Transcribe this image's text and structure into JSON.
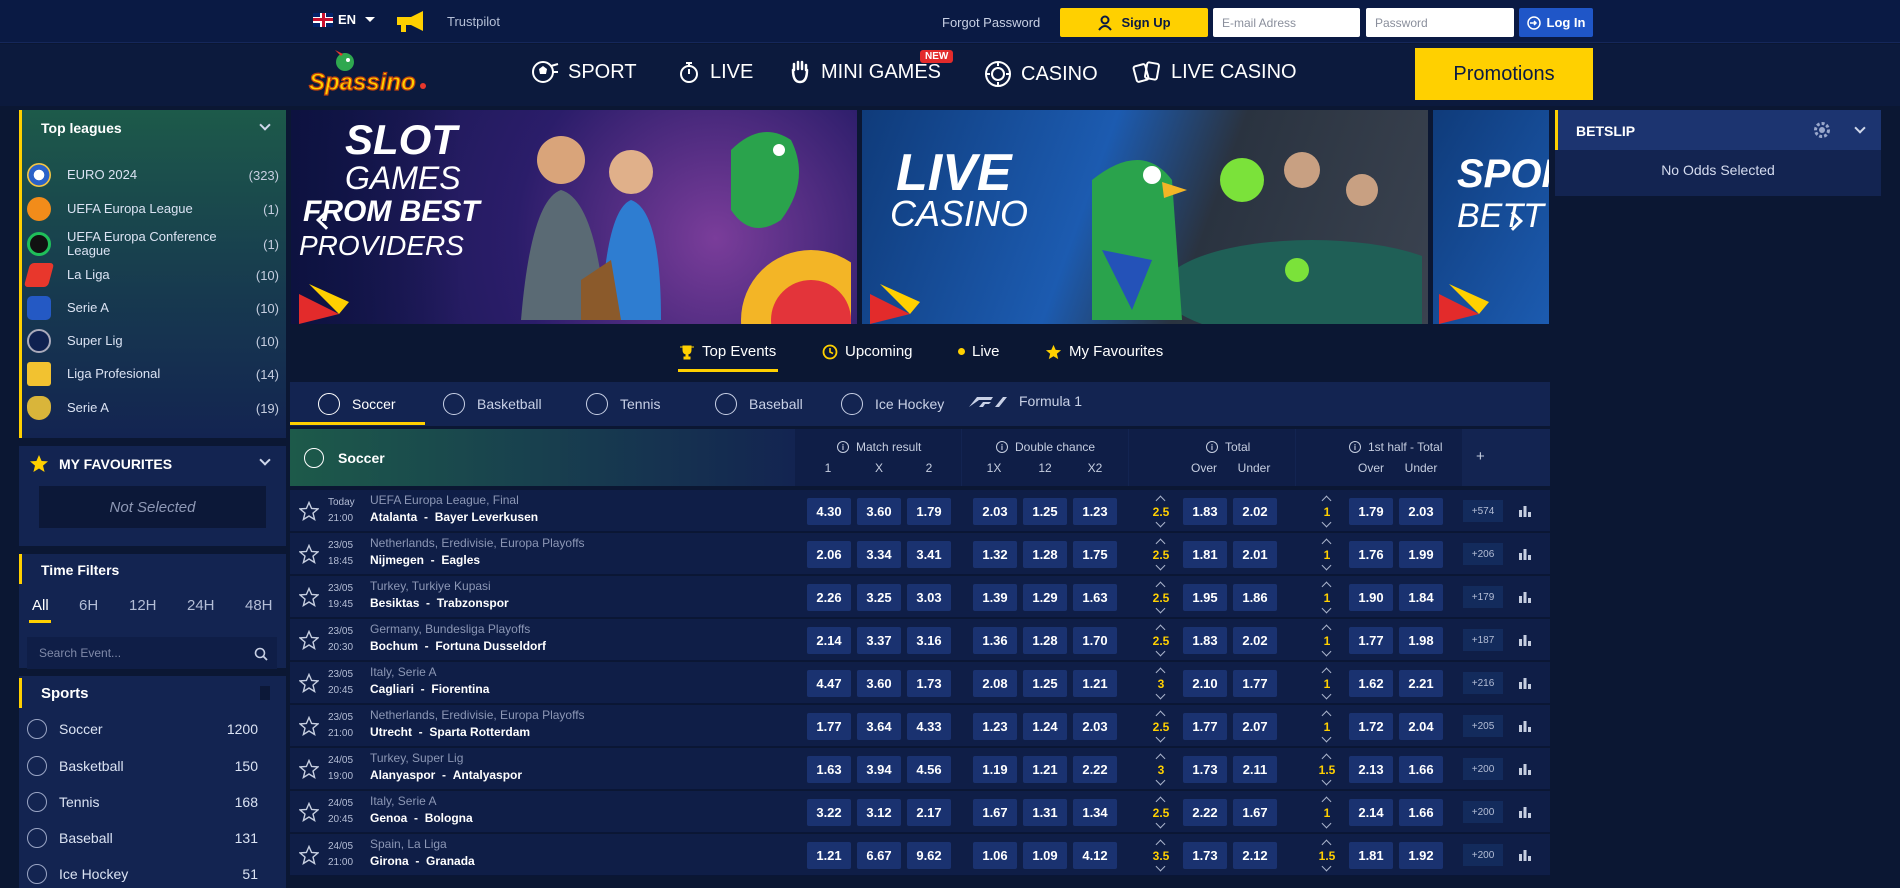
{
  "topbar": {
    "lang": "EN",
    "trustpilot": "Trustpilot",
    "forgot": "Forgot Password",
    "signup": "Sign Up",
    "email_placeholder": "E-mail Adress",
    "password_placeholder": "Password",
    "login": "Log In"
  },
  "nav": {
    "items": [
      "SPORT",
      "LIVE",
      "MINI GAMES",
      "CASINO",
      "LIVE CASINO"
    ],
    "new_badge": "NEW",
    "promotions": "Promotions",
    "logo_text": "Spassino"
  },
  "top_leagues": {
    "title": "Top leagues",
    "items": [
      {
        "name": "EURO 2024",
        "count": "(323)"
      },
      {
        "name": "UEFA Europa League",
        "count": "(1)"
      },
      {
        "name": "UEFA Europa Conference League",
        "count": "(1)"
      },
      {
        "name": "La Liga",
        "count": "(10)"
      },
      {
        "name": "Serie A",
        "count": "(10)"
      },
      {
        "name": "Super Lig",
        "count": "(10)"
      },
      {
        "name": "Liga Profesional",
        "count": "(14)"
      },
      {
        "name": "Serie A",
        "count": "(19)"
      }
    ]
  },
  "favourites": {
    "title": "MY FAVOURITES",
    "empty": "Not Selected"
  },
  "time_filters": {
    "title": "Time Filters",
    "options": [
      "All",
      "6H",
      "12H",
      "24H",
      "48H"
    ],
    "search_placeholder": "Search Event..."
  },
  "sports": {
    "title": "Sports",
    "items": [
      {
        "name": "Soccer",
        "count": "1200"
      },
      {
        "name": "Basketball",
        "count": "150"
      },
      {
        "name": "Tennis",
        "count": "168"
      },
      {
        "name": "Baseball",
        "count": "131"
      },
      {
        "name": "Ice Hockey",
        "count": "51"
      }
    ]
  },
  "banners": {
    "b1": [
      "SLOT",
      "GAMES",
      "FROM BEST",
      "PROVIDERS"
    ],
    "b2": [
      "LIVE",
      "CASINO"
    ],
    "b3": [
      "SPOR",
      "BETT"
    ]
  },
  "betslip": {
    "title": "BETSLIP",
    "empty": "No Odds Selected"
  },
  "event_tabs": [
    "Top Events",
    "Upcoming",
    "Live",
    "My Favourites"
  ],
  "sport_tabs": [
    "Soccer",
    "Basketball",
    "Tennis",
    "Baseball",
    "Ice Hockey",
    "Formula 1"
  ],
  "table": {
    "sport": "Soccer",
    "groups": [
      "Match result",
      "Double chance",
      "Total",
      "1st half - Total"
    ],
    "cols": [
      "1",
      "X",
      "2",
      "1X",
      "12",
      "X2",
      "Over",
      "Under",
      "Over",
      "Under"
    ],
    "plus": "+",
    "rows": [
      {
        "d": "Today",
        "t": "21:00",
        "comp": "UEFA Europa League, Final",
        "home": "Atalanta",
        "away": "Bayer Leverkusen",
        "mr": [
          "4.30",
          "3.60",
          "1.79"
        ],
        "dc": [
          "2.03",
          "1.25",
          "1.23"
        ],
        "tl": "2.5",
        "tot": [
          "1.83",
          "2.02"
        ],
        "hl": "1",
        "ht": [
          "1.79",
          "2.03"
        ],
        "more": "+574"
      },
      {
        "d": "23/05",
        "t": "18:45",
        "comp": "Netherlands, Eredivisie, Europa Playoffs",
        "home": "Nijmegen",
        "away": "Eagles",
        "mr": [
          "2.06",
          "3.34",
          "3.41"
        ],
        "dc": [
          "1.32",
          "1.28",
          "1.75"
        ],
        "tl": "2.5",
        "tot": [
          "1.81",
          "2.01"
        ],
        "hl": "1",
        "ht": [
          "1.76",
          "1.99"
        ],
        "more": "+206"
      },
      {
        "d": "23/05",
        "t": "19:45",
        "comp": "Turkey, Turkiye Kupasi",
        "home": "Besiktas",
        "away": "Trabzonspor",
        "mr": [
          "2.26",
          "3.25",
          "3.03"
        ],
        "dc": [
          "1.39",
          "1.29",
          "1.63"
        ],
        "tl": "2.5",
        "tot": [
          "1.95",
          "1.86"
        ],
        "hl": "1",
        "ht": [
          "1.90",
          "1.84"
        ],
        "more": "+179"
      },
      {
        "d": "23/05",
        "t": "20:30",
        "comp": "Germany, Bundesliga Playoffs",
        "home": "Bochum",
        "away": "Fortuna Dusseldorf",
        "mr": [
          "2.14",
          "3.37",
          "3.16"
        ],
        "dc": [
          "1.36",
          "1.28",
          "1.70"
        ],
        "tl": "2.5",
        "tot": [
          "1.83",
          "2.02"
        ],
        "hl": "1",
        "ht": [
          "1.77",
          "1.98"
        ],
        "more": "+187"
      },
      {
        "d": "23/05",
        "t": "20:45",
        "comp": "Italy, Serie A",
        "home": "Cagliari",
        "away": "Fiorentina",
        "mr": [
          "4.47",
          "3.60",
          "1.73"
        ],
        "dc": [
          "2.08",
          "1.25",
          "1.21"
        ],
        "tl": "3",
        "tot": [
          "2.10",
          "1.77"
        ],
        "hl": "1",
        "ht": [
          "1.62",
          "2.21"
        ],
        "more": "+216"
      },
      {
        "d": "23/05",
        "t": "21:00",
        "comp": "Netherlands, Eredivisie, Europa Playoffs",
        "home": "Utrecht",
        "away": "Sparta Rotterdam",
        "mr": [
          "1.77",
          "3.64",
          "4.33"
        ],
        "dc": [
          "1.23",
          "1.24",
          "2.03"
        ],
        "tl": "2.5",
        "tot": [
          "1.77",
          "2.07"
        ],
        "hl": "1",
        "ht": [
          "1.72",
          "2.04"
        ],
        "more": "+205"
      },
      {
        "d": "24/05",
        "t": "19:00",
        "comp": "Turkey, Super Lig",
        "home": "Alanyaspor",
        "away": "Antalyaspor",
        "mr": [
          "1.63",
          "3.94",
          "4.56"
        ],
        "dc": [
          "1.19",
          "1.21",
          "2.22"
        ],
        "tl": "3",
        "tot": [
          "1.73",
          "2.11"
        ],
        "hl": "1.5",
        "ht": [
          "2.13",
          "1.66"
        ],
        "more": "+200"
      },
      {
        "d": "24/05",
        "t": "20:45",
        "comp": "Italy, Serie A",
        "home": "Genoa",
        "away": "Bologna",
        "mr": [
          "3.22",
          "3.12",
          "2.17"
        ],
        "dc": [
          "1.67",
          "1.31",
          "1.34"
        ],
        "tl": "2.5",
        "tot": [
          "2.22",
          "1.67"
        ],
        "hl": "1",
        "ht": [
          "2.14",
          "1.66"
        ],
        "more": "+200"
      },
      {
        "d": "24/05",
        "t": "21:00",
        "comp": "Spain, La Liga",
        "home": "Girona",
        "away": "Granada",
        "mr": [
          "1.21",
          "6.67",
          "9.62"
        ],
        "dc": [
          "1.06",
          "1.09",
          "4.12"
        ],
        "tl": "3.5",
        "tot": [
          "1.73",
          "2.12"
        ],
        "hl": "1.5",
        "ht": [
          "1.81",
          "1.92"
        ],
        "more": "+200"
      }
    ]
  }
}
